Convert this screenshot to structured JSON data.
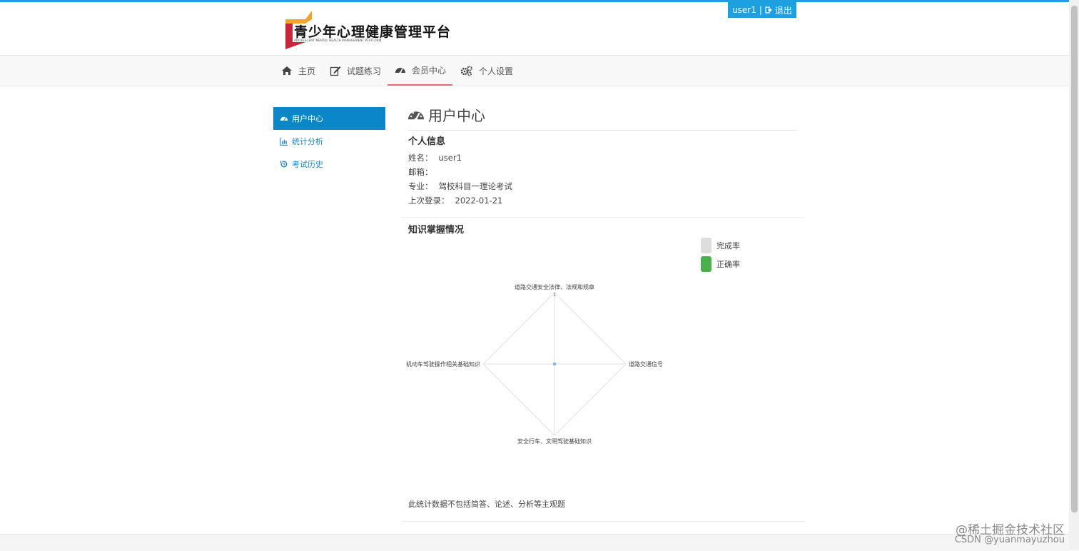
{
  "header": {
    "logo_title": "青少年心理健康管理平台",
    "logo_subtitle": "ADOLESCENT MENTAL HEALTH MANAGEMENT PLATFORM",
    "user": "user1",
    "separator": "|",
    "logout": "退出"
  },
  "nav": {
    "items": [
      {
        "label": "主页",
        "icon": "home-icon"
      },
      {
        "label": "试题练习",
        "icon": "edit-icon"
      },
      {
        "label": "会员中心",
        "icon": "dashboard-icon"
      },
      {
        "label": "个人设置",
        "icon": "gears-icon"
      }
    ],
    "active_index": 2
  },
  "sidebar": {
    "items": [
      {
        "label": "用户中心",
        "icon": "dashboard-icon"
      },
      {
        "label": "统计分析",
        "icon": "bar-chart-icon"
      },
      {
        "label": "考试历史",
        "icon": "history-icon"
      }
    ],
    "active_index": 0
  },
  "main": {
    "title": "用户中心",
    "personal_info": {
      "heading": "个人信息",
      "rows": [
        {
          "label": "姓名：",
          "value": "user1"
        },
        {
          "label": "邮箱：",
          "value": ""
        },
        {
          "label": "专业：",
          "value": "驾校科目一理论考试"
        },
        {
          "label": "上次登录：",
          "value": "2022-01-21"
        }
      ]
    },
    "knowledge": {
      "heading": "知识掌握情况",
      "legend": [
        {
          "label": "完成率",
          "color": "#dddddd"
        },
        {
          "label": "正确率",
          "color": "#4cae4c"
        }
      ]
    },
    "note": "此统计数据不包括简答、论述、分析等主观题"
  },
  "chart_data": {
    "type": "radar",
    "axes": [
      "道路交通安全法律、法规和规章",
      "道路交通信号",
      "安全行车、文明驾驶基础知识",
      "机动车驾驶操作相关基础知识"
    ],
    "series": [
      {
        "name": "完成率",
        "values": [
          0,
          0,
          0,
          0
        ]
      },
      {
        "name": "正确率",
        "values": [
          0,
          0,
          0,
          0
        ]
      }
    ],
    "tick_labels": [
      "1"
    ],
    "range": [
      0,
      1
    ]
  },
  "watermark": {
    "line1": "@稀土掘金技术社区",
    "line2": "CSDN @yuanmayuzhou"
  }
}
